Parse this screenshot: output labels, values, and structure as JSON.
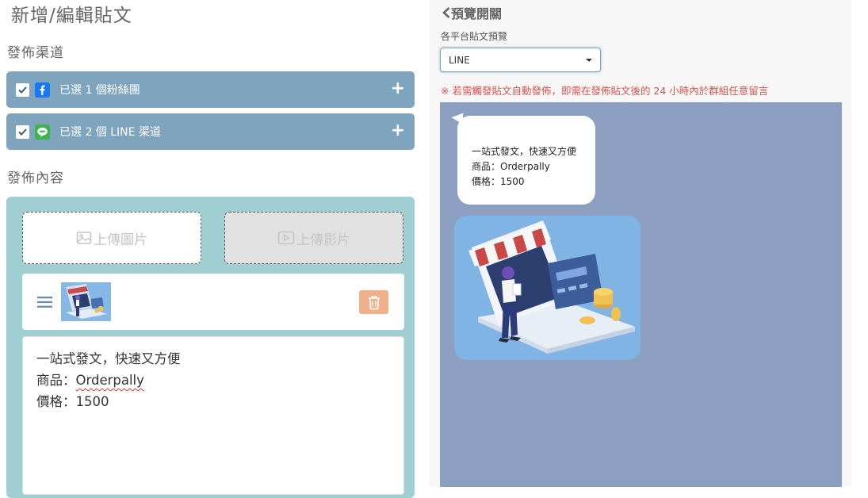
{
  "left": {
    "page_title": "新增/編輯貼文",
    "channel_section_title": "發佈渠道",
    "channels": [
      {
        "label": "已選 1 個粉絲團",
        "icon": "facebook-icon",
        "color": "#1877f2"
      },
      {
        "label": "已選 2 個 LINE 渠道",
        "icon": "line-icon",
        "color": "#3bb54a"
      }
    ],
    "content_section_title": "發佈內容",
    "upload_image_label": "上傳圖片",
    "upload_video_label": "上傳影片",
    "post_text": {
      "line1": "一站式發文，快速又方便",
      "line2_prefix": "商品：",
      "line2_product": "Orderpally",
      "line3": "價格：1500"
    }
  },
  "right": {
    "preview_toggle": "預覽開關",
    "preview_label": "各平台貼文預覽",
    "platform_selected": "LINE",
    "warning": "※ 若需觸發貼文自動發佈，即需在發佈貼文後的 24 小時內於群組任意留言",
    "bubble_lines": [
      "一站式發文，快速又方便",
      "商品：Orderpally",
      "價格：1500"
    ]
  },
  "colors": {
    "channel_bar": "#7fa4bd",
    "content_box": "#9fcfd2",
    "preview_bg": "#8c9fc0",
    "warning": "#d9534f",
    "delete_button": "#f0b08a"
  }
}
